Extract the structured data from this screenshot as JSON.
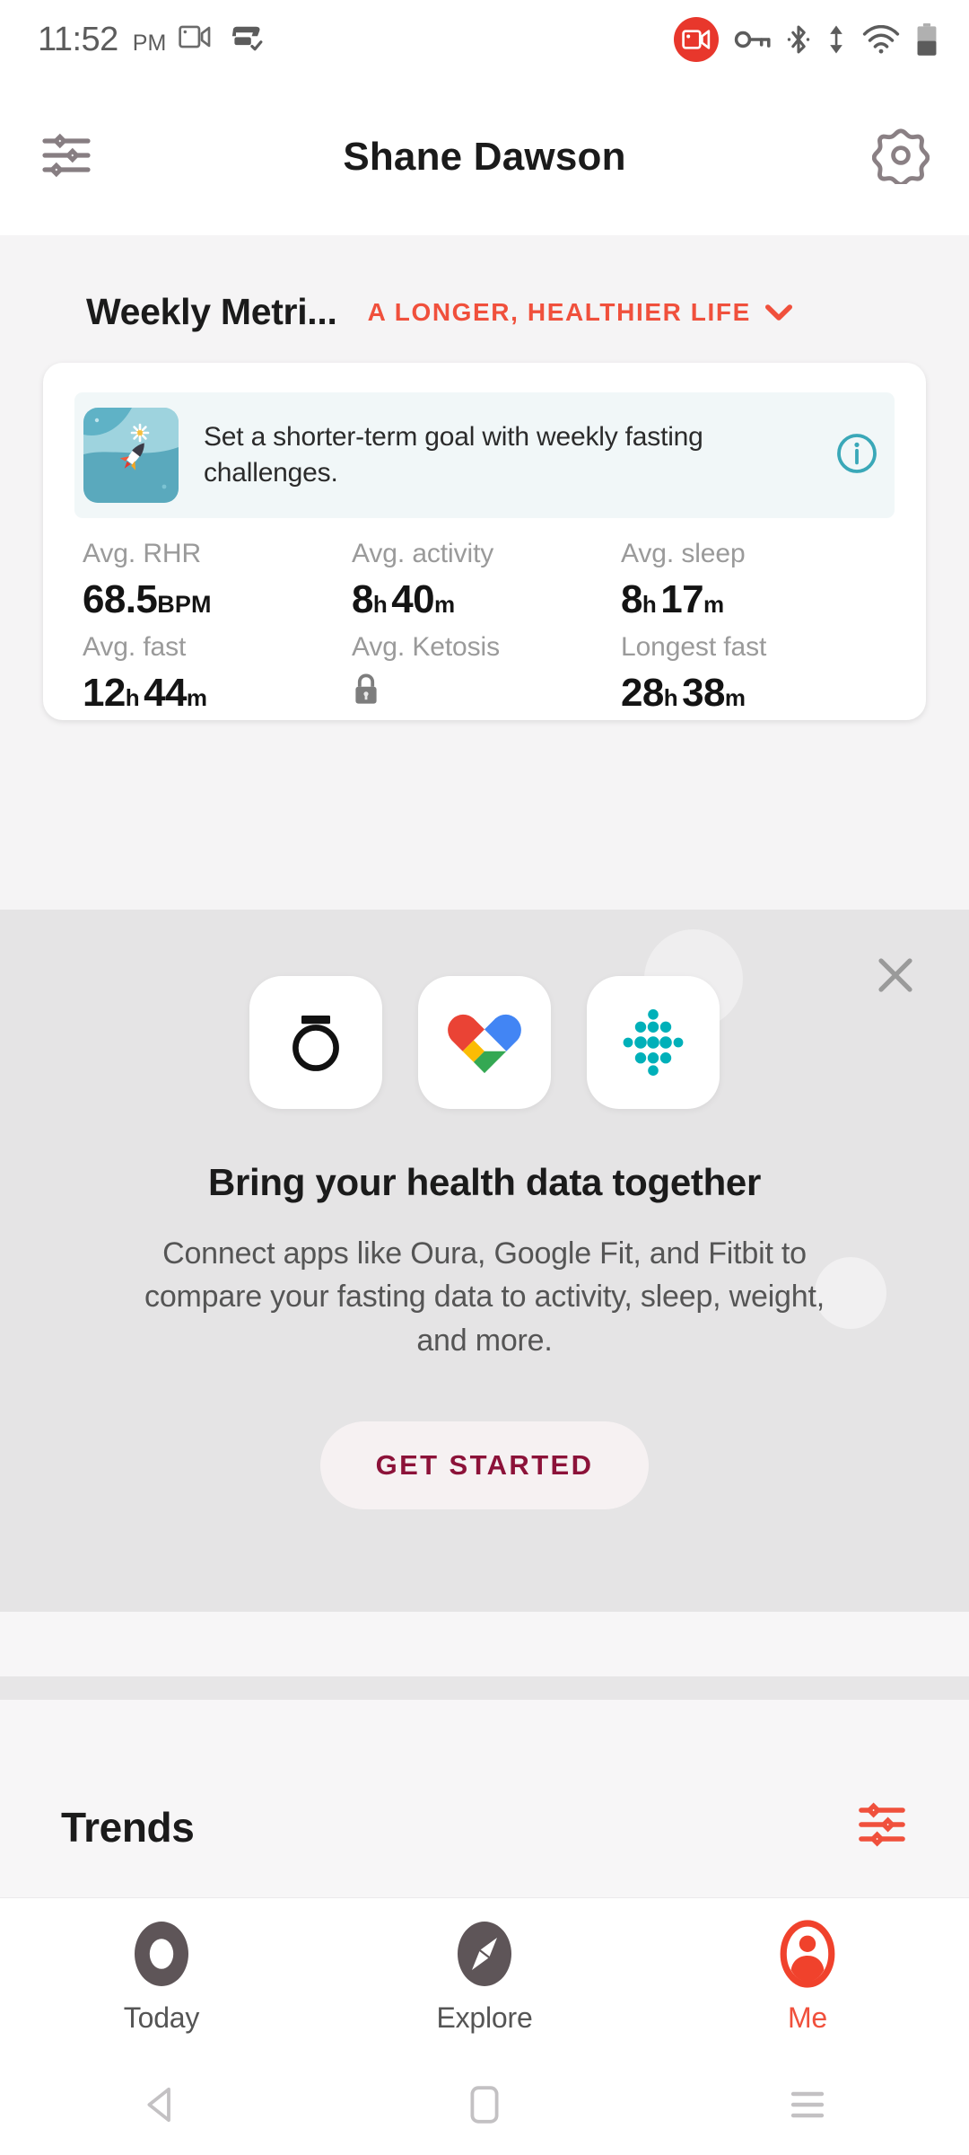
{
  "status_bar": {
    "time": "11:52",
    "ampm": "PM",
    "icons_left": [
      "screen-record-icon",
      "vpn-glasses-icon"
    ],
    "icons_right": [
      "recording-badge-icon",
      "vpn-key-icon",
      "bluetooth-icon",
      "data-transfer-icon",
      "wifi-icon",
      "battery-icon"
    ]
  },
  "header": {
    "title": "Shane Dawson",
    "left_icon": "sliders-icon",
    "right_icon": "gear-icon"
  },
  "weekly_metrics": {
    "title": "Weekly Metri...",
    "goal_label": "A LONGER, HEALTHIER LIFE",
    "goal_chevron": "chevron-down-icon",
    "promo": {
      "text": "Set a shorter-term goal with weekly fasting challenges.",
      "thumb_icon": "rocket-illustration",
      "info_icon": "info-icon"
    },
    "metrics": [
      {
        "label": "Avg. RHR",
        "value": "68.5",
        "unit": "BPM",
        "locked": false
      },
      {
        "label": "Avg. activity",
        "value": "8",
        "unit": "h",
        "value2": "40",
        "unit2": "m",
        "locked": false
      },
      {
        "label": "Avg. sleep",
        "value": "8",
        "unit": "h",
        "value2": "17",
        "unit2": "m",
        "locked": false
      },
      {
        "label": "Avg. fast",
        "value": "12",
        "unit": "h",
        "value2": "44",
        "unit2": "m",
        "locked": false
      },
      {
        "label": "Avg. Ketosis",
        "value": "",
        "unit": "",
        "locked": true
      },
      {
        "label": "Longest fast",
        "value": "28",
        "unit": "h",
        "value2": "38",
        "unit2": "m",
        "locked": false
      }
    ]
  },
  "integration_promo": {
    "close_icon": "close-icon",
    "app_tiles": [
      {
        "name": "oura-icon",
        "label": "Oura"
      },
      {
        "name": "google-fit-icon",
        "label": "Google Fit"
      },
      {
        "name": "fitbit-icon",
        "label": "Fitbit"
      }
    ],
    "heading": "Bring your health data together",
    "body": "Connect apps like Oura, Google Fit, and Fitbit to compare your fasting data to activity, sleep, weight, and more.",
    "cta_label": "GET STARTED"
  },
  "trends": {
    "title": "Trends",
    "filter_icon": "sliders-filter-icon"
  },
  "tabs": [
    {
      "label": "Today",
      "icon": "ring-icon",
      "active": false
    },
    {
      "label": "Explore",
      "icon": "compass-icon",
      "active": false
    },
    {
      "label": "Me",
      "icon": "person-icon",
      "active": true
    }
  ],
  "android_nav": {
    "back": "back-triangle-icon",
    "home": "home-square-icon",
    "recents": "recents-lines-icon"
  },
  "colors": {
    "accent_red": "#f0503c",
    "cta_text": "#8c1239",
    "info_teal": "#3aa8b8",
    "page_bg": "#f5f4f5",
    "promo_bg": "#e5e4e5"
  }
}
